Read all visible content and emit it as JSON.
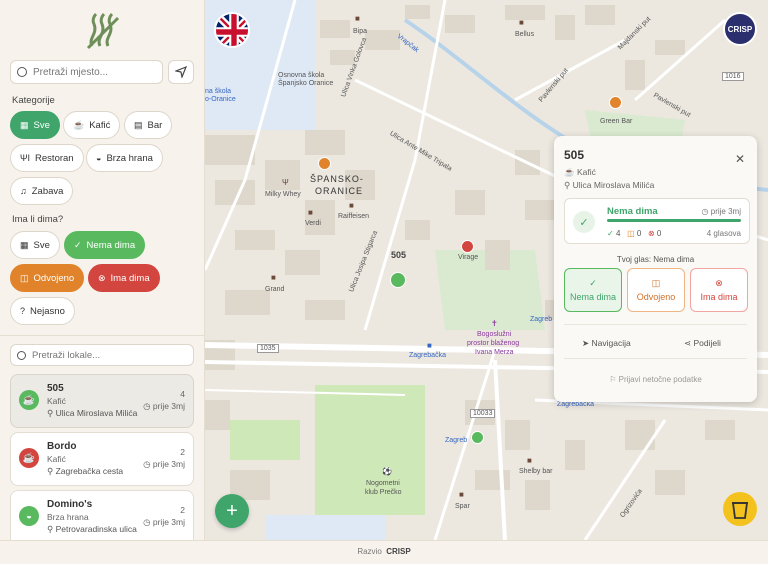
{
  "sidebar": {
    "search_placeholder": "Pretraži mjesto...",
    "categories_label": "Kategorije",
    "categories": [
      {
        "label": "Sve",
        "glyph": "▦"
      },
      {
        "label": "Kafić",
        "glyph": "☕"
      },
      {
        "label": "Bar",
        "glyph": "▤"
      },
      {
        "label": "Restoran",
        "glyph": "ΨΙ"
      },
      {
        "label": "Brza hrana",
        "glyph": "◒"
      },
      {
        "label": "Zabava",
        "glyph": "♫"
      }
    ],
    "smoke_label": "Ima li dima?",
    "smoke_filters": [
      {
        "label": "Sve",
        "glyph": "▦"
      },
      {
        "label": "Nema dima",
        "glyph": "✓"
      },
      {
        "label": "Odvojeno",
        "glyph": "◫"
      },
      {
        "label": "Ima dima",
        "glyph": "⊗"
      },
      {
        "label": "Nejasno",
        "glyph": "?"
      }
    ],
    "venue_search_placeholder": "Pretraži lokale...",
    "venues": [
      {
        "name": "505",
        "type": "Kafić",
        "address": "Ulica Miroslava Milića",
        "count": "4",
        "when": "prije 3mj",
        "color": "#58b95e",
        "glyph": "☕"
      },
      {
        "name": "Bordo",
        "type": "Kafić",
        "address": "Zagrebačka cesta",
        "count": "2",
        "when": "prije 3mj",
        "color": "#d2463f",
        "glyph": "☕"
      },
      {
        "name": "Domino's",
        "type": "Brza hrana",
        "address": "Petrovaradinska ulica",
        "count": "2",
        "when": "prije 3mj",
        "color": "#58b95e",
        "glyph": "◒"
      }
    ]
  },
  "map": {
    "labels": {
      "osnovna": "Osnovna škola",
      "spansko_oranice": "Španjsko Oranice",
      "osnovna2": "na škola",
      "oranice2": "o-Oranice",
      "vrapcak": "Vrapčak",
      "bipa": "Bipa",
      "bellus": "Bellus",
      "ulica_vinko": "Ulica Vinka Golovca",
      "ulica_ante": "Ulica Ante Mike Tripala",
      "district": "ŠPANSKO-",
      "district2": "ORANICE",
      "milky": "Milky Whey",
      "verdi": "Verdi",
      "raiffeisen": "Raiffeisen",
      "virage": "Virage",
      "grand": "Grand",
      "jospia": "Ulica Josipa Stigarca",
      "label_505": "505",
      "bogosluzni": "Bogoslužni",
      "prostor": "prostor blaženog",
      "ivana": "Ivana Merza",
      "zagrebacka": "Zagrebačka",
      "zagreb2": "Zagreb",
      "zagrebacka3": "Zagrebačka",
      "road1035": "1035",
      "road10033": "10033",
      "road1016": "1016",
      "nogometni": "Nogometni",
      "klub": "klub Prečko",
      "shelby": "Shelby bar",
      "spar": "Spar",
      "green_bar": "Green Bar",
      "pavlenski": "Pavlenski put",
      "majdanski": "Majdanski put",
      "pavlenski2": "Pavlenski put",
      "ogrizovic": "Ogrizovića"
    }
  },
  "lang_flag": "UK",
  "crisp_label": "CRISP",
  "card": {
    "name": "505",
    "type": "Kafić",
    "address": "Ulica Miroslava Milića",
    "status_title": "Nema dima",
    "status_time": "prije 3mj",
    "progress": 1.0,
    "count_green": "4",
    "count_orange": "0",
    "count_red": "0",
    "votes": "4 glasova",
    "your_vote": "Tvoj glas: Nema dima",
    "vote_green": "Nema dima",
    "vote_orange": "Odvojeno",
    "vote_red": "Ima dima",
    "nav": "Navigacija",
    "share": "Podijeli",
    "report": "Prijavi netočne podatke"
  },
  "footer": {
    "prefix": "Razvio",
    "brand": "CRISP"
  }
}
